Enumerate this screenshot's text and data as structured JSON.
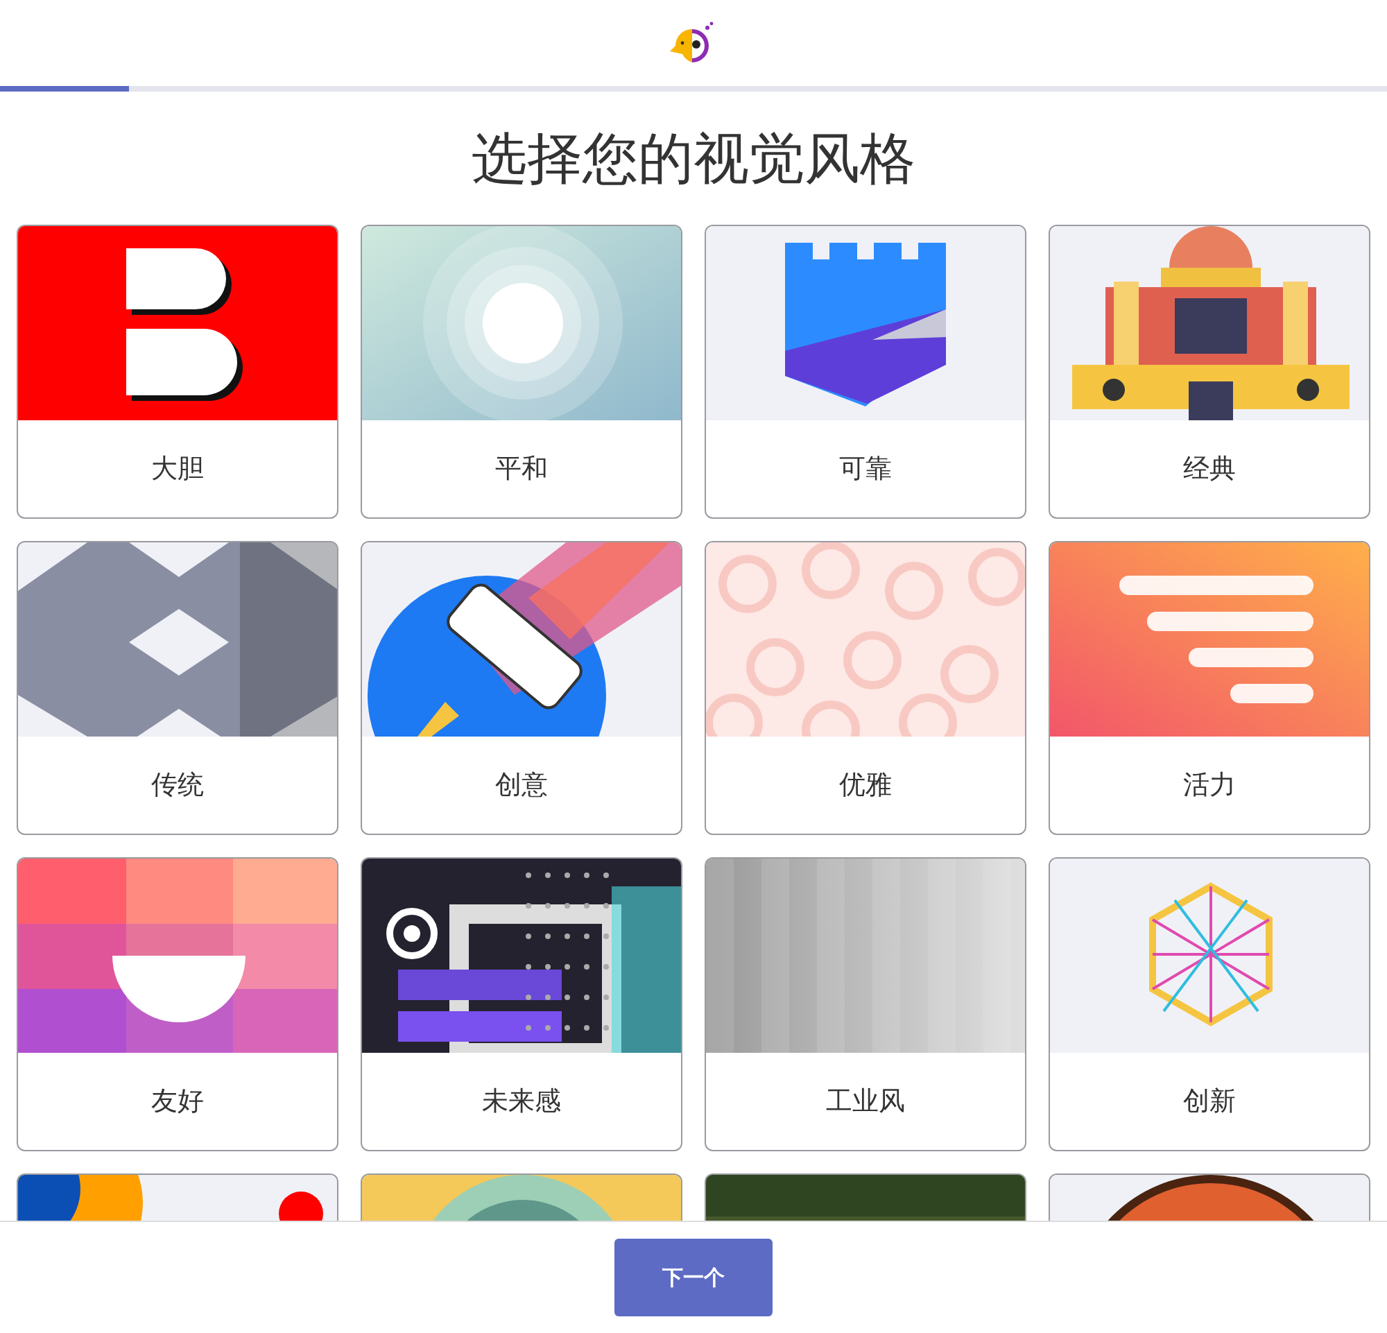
{
  "progress": {
    "level": 0.093
  },
  "title": "选择您的视觉风格",
  "cards": [
    {
      "label": "大胆",
      "kind": "bold"
    },
    {
      "label": "平和",
      "kind": "calm"
    },
    {
      "label": "可靠",
      "kind": "reliable"
    },
    {
      "label": "经典",
      "kind": "classic"
    },
    {
      "label": "传统",
      "kind": "traditional"
    },
    {
      "label": "创意",
      "kind": "creative"
    },
    {
      "label": "优雅",
      "kind": "elegant"
    },
    {
      "label": "活力",
      "kind": "energetic"
    },
    {
      "label": "友好",
      "kind": "friendly"
    },
    {
      "label": "未来感",
      "kind": "futuristic"
    },
    {
      "label": "工业风",
      "kind": "industrial"
    },
    {
      "label": "创新",
      "kind": "innovative"
    },
    {
      "kind": "circles"
    },
    {
      "kind": "rings"
    },
    {
      "kind": "texture"
    },
    {
      "kind": "badge"
    }
  ],
  "next_button": "下一个"
}
